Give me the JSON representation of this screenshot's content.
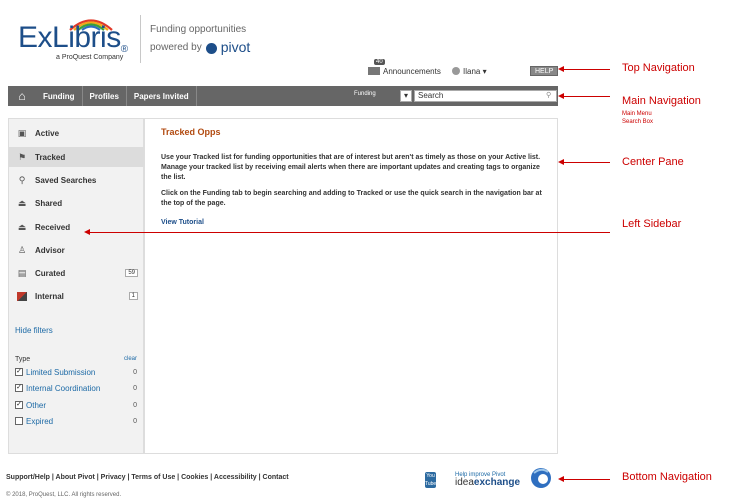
{
  "header": {
    "logo_word": "ExLibris",
    "logo_registered": "®",
    "logo_sub": "a ProQuest Company",
    "brand_title": "Funding opportunities",
    "brand_powered": "powered by",
    "brand_pivot": "pivot"
  },
  "topnav": {
    "announcements_badge": "40",
    "announcements_label": "Announcements",
    "user_label": "Ilana ▾",
    "help_label": "HELP"
  },
  "mainnav": {
    "home_icon": "⌂",
    "items": [
      "Funding",
      "Profiles",
      "Papers Invited"
    ],
    "search_scope": "Funding",
    "search_value": "Search"
  },
  "sidebar": {
    "items": [
      {
        "label": "Active",
        "icon": "plus-square-icon",
        "count": ""
      },
      {
        "label": "Tracked",
        "icon": "flag-icon",
        "count": ""
      },
      {
        "label": "Saved Searches",
        "icon": "magnifier-icon",
        "count": ""
      },
      {
        "label": "Shared",
        "icon": "tray-icon",
        "count": ""
      },
      {
        "label": "Received",
        "icon": "inbox-icon",
        "count": ""
      },
      {
        "label": "Advisor",
        "icon": "person-icon",
        "count": ""
      },
      {
        "label": "Curated",
        "icon": "list-icon",
        "count": "59"
      },
      {
        "label": "Internal",
        "icon": "bookmark-icon",
        "count": "1"
      }
    ],
    "active_index": 1,
    "hide_filters": "Hide filters",
    "type_label": "Type",
    "clear_label": "clear",
    "filters": [
      {
        "label": "Limited Submission",
        "count": "0",
        "checked": true
      },
      {
        "label": "Internal Coordination",
        "count": "0",
        "checked": true
      },
      {
        "label": "Other",
        "count": "0",
        "checked": true
      },
      {
        "label": "Expired",
        "count": "0",
        "checked": false
      }
    ]
  },
  "center": {
    "title": "Tracked Opps",
    "paragraph1": "Use your Tracked list for funding opportunities that are of interest but aren't as timely as those on your Active list. Manage your tracked list by receiving email alerts when there are important updates and creating tags to organize the list.",
    "paragraph2": "Click on the Funding tab to begin searching and adding to Tracked or use the quick search in the navigation bar at the top of the page.",
    "tutorial_link": "View Tutorial"
  },
  "footer": {
    "links": "Support/Help  |  About Pivot  |  Privacy  |  Terms of Use  |  Cookies  |  Accessibility  |  Contact",
    "copyright": "© 2018, ProQuest, LLC. All rights reserved.",
    "youtube_label": "You Tube",
    "ideax_small": "Help improve Pivot",
    "ideax_idea": "idea",
    "ideax_exchange": "exchange"
  },
  "annotations": {
    "top_navigation": "Top Navigation",
    "main_navigation": "Main Navigation",
    "main_menu": "Main Menu",
    "search_box": "Search Box",
    "center_pane": "Center Pane",
    "left_sidebar": "Left Sidebar",
    "bottom_navigation": "Bottom Navigation"
  },
  "colors": {
    "annotation_red": "#cc0000",
    "nav_gray": "#666666",
    "title_orange": "#b14a10",
    "link_blue": "#1d6aa6",
    "brand_blue": "#1d4e89"
  }
}
